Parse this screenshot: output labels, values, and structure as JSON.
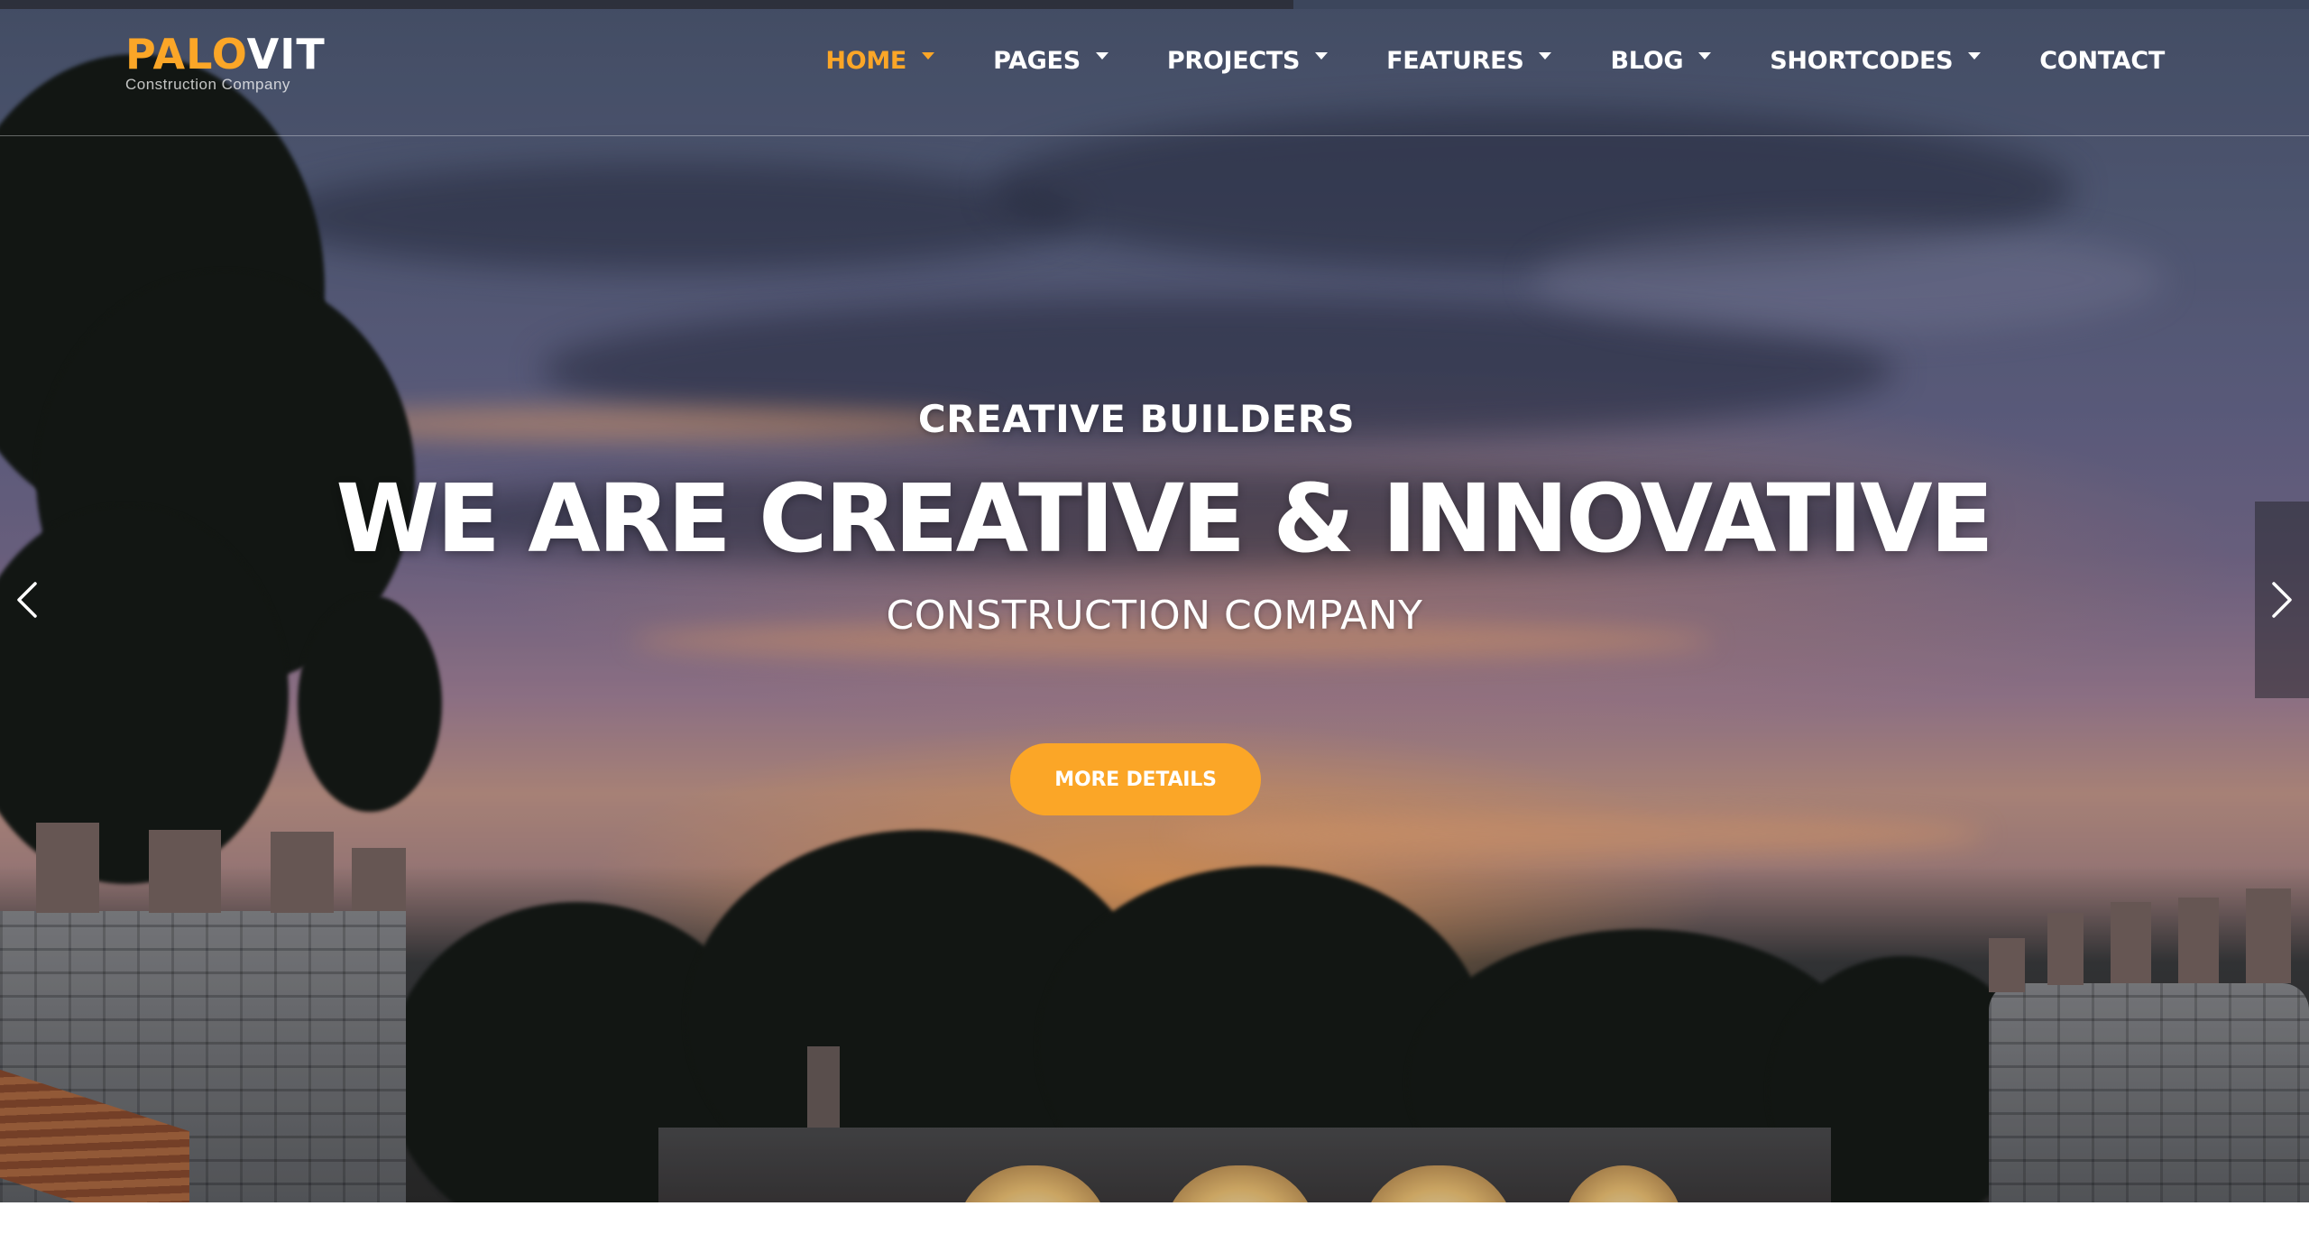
{
  "brand": {
    "logo_part1": "PALO",
    "logo_part2": "VIT",
    "tagline": "Construction Company",
    "accent_color": "#fba627"
  },
  "nav": {
    "items": [
      {
        "label": "HOME",
        "active": true,
        "has_dropdown": true
      },
      {
        "label": "PAGES",
        "active": false,
        "has_dropdown": true
      },
      {
        "label": "PROJECTS",
        "active": false,
        "has_dropdown": true
      },
      {
        "label": "FEATURES",
        "active": false,
        "has_dropdown": true
      },
      {
        "label": "BLOG",
        "active": false,
        "has_dropdown": true
      },
      {
        "label": "SHORTCODES",
        "active": false,
        "has_dropdown": true
      },
      {
        "label": "CONTACT",
        "active": false,
        "has_dropdown": false
      }
    ]
  },
  "hero": {
    "pretitle": "CREATIVE BUILDERS",
    "headline": "WE ARE CREATIVE & INNOVATIVE",
    "subtitle": "CONSTRUCTION COMPANY",
    "cta_label": "MORE DETAILS",
    "slide_progress": 0.56
  },
  "icons": {
    "prev": "chevron-left-icon",
    "next": "chevron-right-icon",
    "dropdown": "caret-down-icon"
  }
}
